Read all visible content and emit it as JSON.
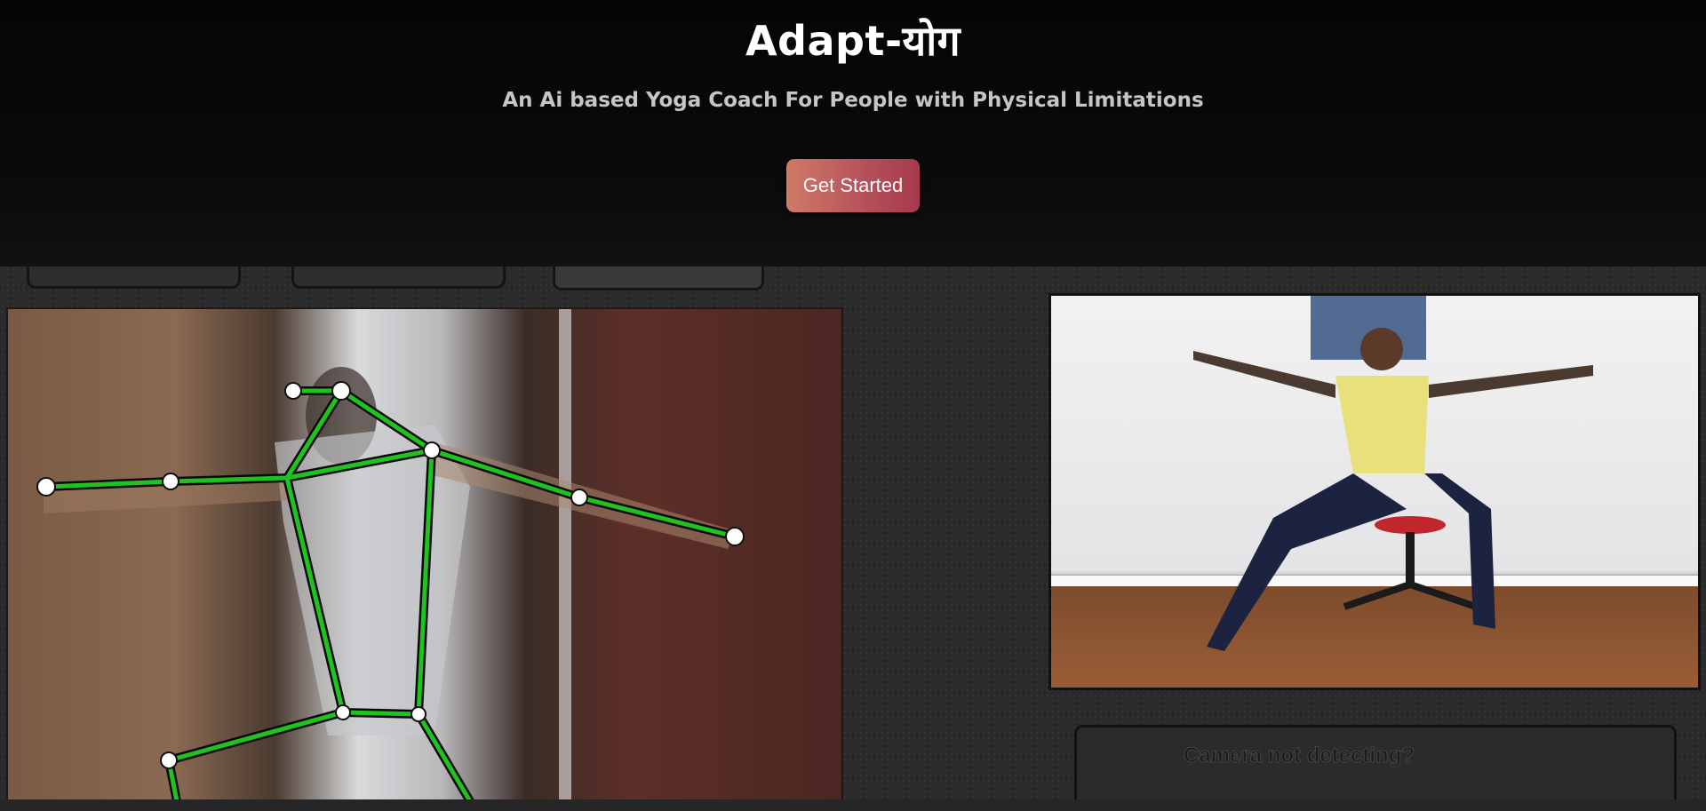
{
  "hero": {
    "title": "Adapt-योग",
    "subtitle": "An Ai based Yoga Coach For People with Physical Limitations",
    "cta_label": "Get Started"
  },
  "reference": {
    "hint_text": "Camera not detecting?"
  },
  "colors": {
    "accent_start": "#d07a69",
    "accent_end": "#a63a4d",
    "skeleton_line": "#1fc21f",
    "joint": "#ffffff"
  },
  "icons": [
    "pose-skeleton-overlay"
  ]
}
